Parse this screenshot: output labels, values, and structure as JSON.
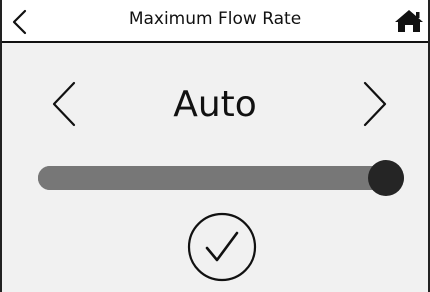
{
  "header": {
    "title": "Maximum Flow Rate",
    "back_icon": "chevron-left-icon",
    "home_icon": "home-icon"
  },
  "selector": {
    "value": "Auto",
    "prev_icon": "chevron-left-icon",
    "next_icon": "chevron-right-icon"
  },
  "slider": {
    "level": 0.95
  },
  "confirm": {
    "icon": "check-circle-icon"
  }
}
